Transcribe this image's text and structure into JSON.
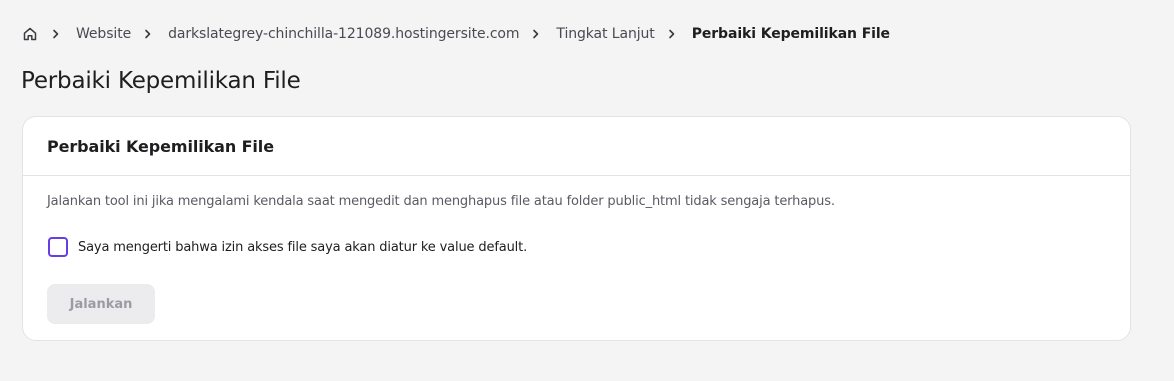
{
  "breadcrumb": {
    "home_icon": "home-icon",
    "separator_icon": "chevron-right-icon",
    "items": [
      "Website",
      "darkslategrey-chinchilla-121089.hostingersite.com",
      "Tingkat Lanjut",
      "Perbaiki Kepemilikan File"
    ]
  },
  "page": {
    "title": "Perbaiki Kepemilikan File"
  },
  "card": {
    "title": "Perbaiki Kepemilikan File",
    "description": "Jalankan tool ini jika mengalami kendala saat mengedit dan menghapus file atau folder public_html tidak sengaja terhapus.",
    "checkbox_label": "Saya mengerti bahwa izin akses file saya akan diatur ke value default.",
    "checkbox_checked": false,
    "button_label": "Jalankan",
    "button_disabled": true
  },
  "colors": {
    "accent": "#673de6",
    "background": "#f4f4f4",
    "card": "#ffffff",
    "disabled_button_bg": "#ececee",
    "disabled_button_text": "#9b9ba3"
  }
}
